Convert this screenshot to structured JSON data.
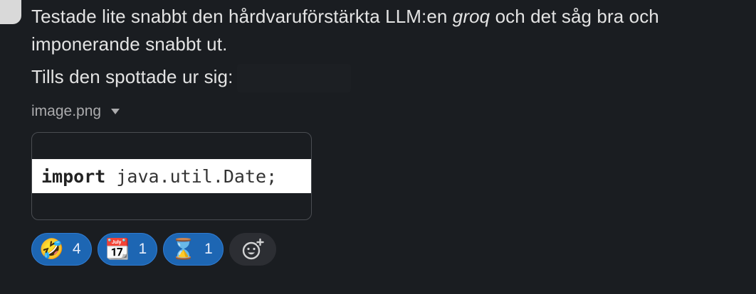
{
  "message": {
    "line1_before": "Testade lite snabbt den hårdvaruförstärkta LLM:en ",
    "line1_italic": "groq",
    "line1_after": " och det såg bra och",
    "line2": "imponerande snabbt ut.",
    "line3": "Tills den spottade ur sig:"
  },
  "attachment": {
    "filename": "image.png",
    "code_keyword": "import",
    "code_rest": " java.util.Date;"
  },
  "reactions": [
    {
      "emoji": "🤣",
      "icon": "rofl-emoji-icon",
      "count": "4"
    },
    {
      "emoji": "📆",
      "icon": "calendar-emoji-icon",
      "count": "1"
    },
    {
      "emoji": "⌛",
      "icon": "hourglass-emoji-icon",
      "count": "1"
    }
  ],
  "colors": {
    "background": "#1a1d21",
    "reaction_active": "#1d66b3",
    "text": "#e3e3e3"
  }
}
